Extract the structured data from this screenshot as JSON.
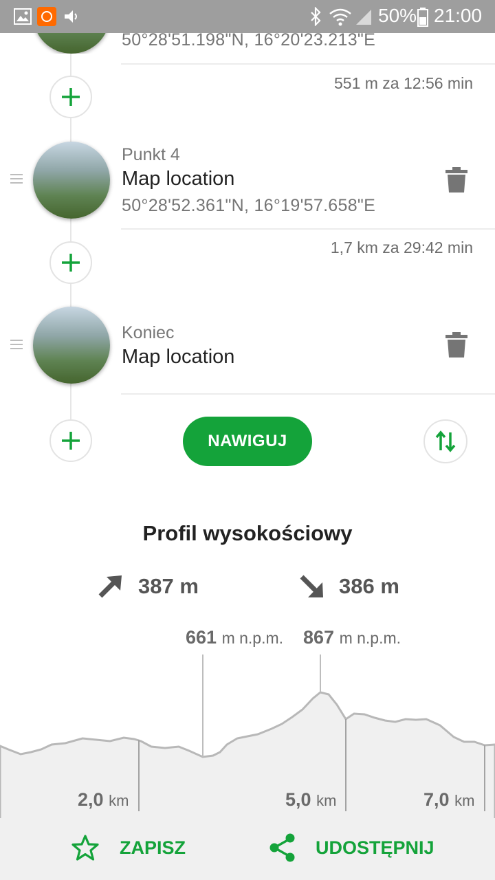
{
  "status_bar": {
    "battery": "50%",
    "time": "21:00",
    "icons": [
      "gallery-icon",
      "app-notification-icon",
      "volume-icon",
      "bluetooth-icon",
      "wifi-icon",
      "signal-icon",
      "battery-icon"
    ]
  },
  "route": {
    "top_coords": "50°28'51.198\"N, 16°20'23.213\"E",
    "segment1": "551 m za 12:56 min",
    "waypoint4": {
      "label": "Punkt 4",
      "title": "Map location",
      "coords": "50°28'52.361\"N, 16°19'57.658\"E"
    },
    "segment2": "1,7 km za 29:42 min",
    "end": {
      "label": "Koniec",
      "title": "Map location"
    },
    "navigate_label": "NAWIGUJ"
  },
  "profile": {
    "title": "Profil wysokościowy",
    "ascent": "387 m",
    "descent": "386 m",
    "peak_low": {
      "value": "661",
      "unit": "m n.p.m."
    },
    "peak_high": {
      "value": "867",
      "unit": "m n.p.m."
    },
    "km_marks": [
      {
        "value": "2,0",
        "unit": "km"
      },
      {
        "value": "5,0",
        "unit": "km"
      },
      {
        "value": "7,0",
        "unit": "km"
      }
    ]
  },
  "actions": {
    "save_label": "ZAPISZ",
    "share_label": "UDOSTĘPNIJ"
  },
  "colors": {
    "accent": "#14a33a",
    "status_bar": "#9e9e9e",
    "profile_fill": "#f0f0f0"
  }
}
